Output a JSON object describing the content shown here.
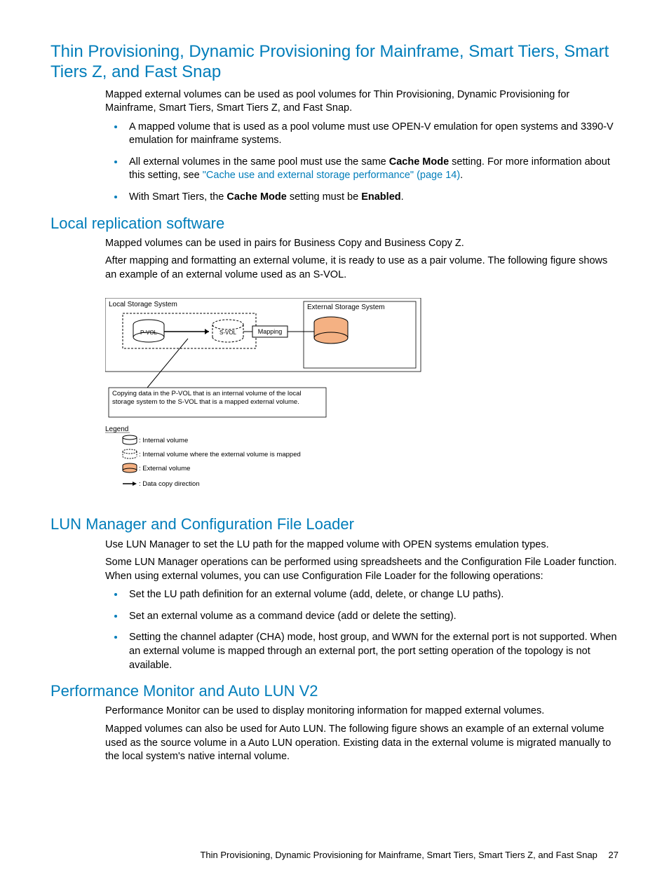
{
  "sec1": {
    "title": "Thin Provisioning, Dynamic Provisioning for Mainframe, Smart Tiers, Smart Tiers Z, and Fast Snap",
    "p1": "Mapped external volumes can be used as pool volumes for Thin Provisioning, Dynamic Provisioning for Mainframe, Smart Tiers, Smart Tiers Z, and Fast Snap.",
    "b1": "A mapped volume that is used as a pool volume must use OPEN-V emulation for open systems and 3390-V emulation for mainframe systems.",
    "b2a": "All external volumes in the same pool must use the same ",
    "b2b": "Cache Mode",
    "b2c": " setting. For more information about this setting, see ",
    "b2link": "\"Cache use and external storage performance\" (page 14)",
    "b2d": ".",
    "b3a": "With Smart Tiers, the ",
    "b3b": "Cache Mode",
    "b3c": " setting must be ",
    "b3d": "Enabled",
    "b3e": "."
  },
  "sec2": {
    "title": "Local replication software",
    "p1": "Mapped volumes can be used in pairs for Business Copy and Business Copy Z.",
    "p2": "After mapping and formatting an external volume, it is ready to use as a pair volume. The following figure shows an example of an external volume used as an S-VOL."
  },
  "diagram": {
    "local": "Local Storage System",
    "external": "External Storage System",
    "pvol": "P-VOL",
    "svol": "S-VOL",
    "mapping": "Mapping",
    "caption": "Copying data in the P-VOL that is an internal volume of the local storage system to the S-VOL that is a mapped external volume.",
    "legend": "Legend",
    "l1": ": Internal volume",
    "l2": ": Internal volume where the external volume is mapped",
    "l3": ": External volume",
    "l4": ": Data copy direction"
  },
  "sec3": {
    "title": "LUN Manager and Configuration File Loader",
    "p1": "Use LUN Manager to set the LU path for the mapped volume with OPEN systems emulation types.",
    "p2": "Some LUN Manager operations can be performed using spreadsheets and the Configuration File Loader function. When using external volumes, you can use Configuration File Loader for the following operations:",
    "b1": "Set the LU path definition for an external volume (add, delete, or change LU paths).",
    "b2": "Set an external volume as a command device (add or delete the setting).",
    "b3": "Setting the channel adapter (CHA) mode, host group, and WWN for the external port is not supported. When an external volume is mapped through an external port, the port setting operation of the topology is not available."
  },
  "sec4": {
    "title": "Performance Monitor and Auto LUN V2",
    "p1": "Performance Monitor can be used to display monitoring information for mapped external volumes.",
    "p2": "Mapped volumes can also be used for Auto LUN. The following figure shows an example of an external volume used as the source volume in a Auto LUN operation. Existing data in the external volume is migrated manually to the local system's native internal volume."
  },
  "footer": {
    "text": "Thin Provisioning, Dynamic Provisioning for Mainframe, Smart Tiers, Smart Tiers Z, and Fast Snap",
    "page": "27"
  }
}
